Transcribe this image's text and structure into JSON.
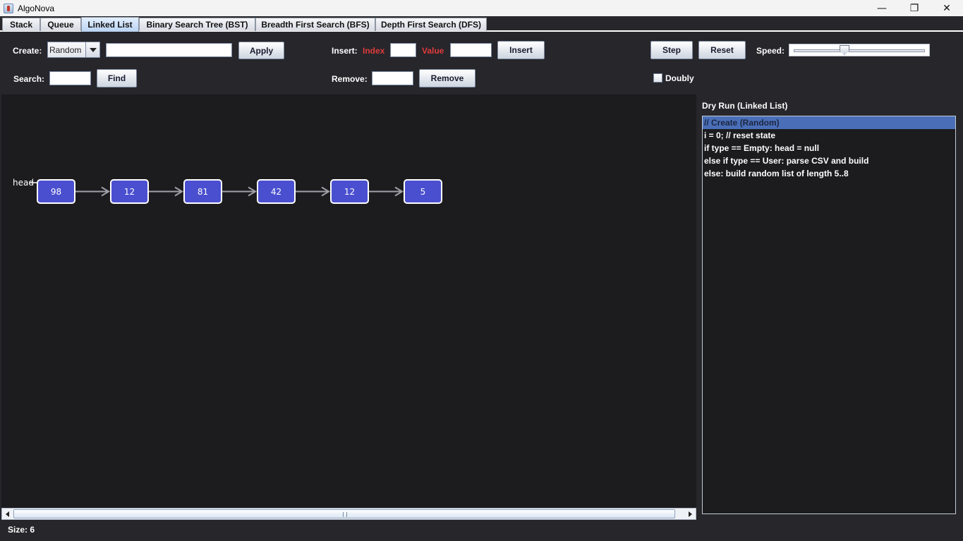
{
  "window": {
    "title": "AlgoNova"
  },
  "tabs": [
    {
      "label": "Stack"
    },
    {
      "label": "Queue"
    },
    {
      "label": "Linked List",
      "active": true
    },
    {
      "label": "Binary Search Tree (BST)"
    },
    {
      "label": "Breadth First Search (BFS)"
    },
    {
      "label": "Depth First Search (DFS)"
    }
  ],
  "toolbar": {
    "create_label": "Create:",
    "create_type": "Random",
    "create_input": "",
    "apply_label": "Apply",
    "insert_label": "Insert:",
    "index_label": "Index",
    "value_label": "Value",
    "index_input": "",
    "value_input": "",
    "insert_button": "Insert",
    "step_button": "Step",
    "reset_button": "Reset",
    "speed_label": "Speed:",
    "speed_fraction": 0.38,
    "search_label": "Search:",
    "search_input": "",
    "find_button": "Find",
    "remove_label": "Remove:",
    "remove_input": "",
    "remove_button": "Remove",
    "doubly_label": "Doubly",
    "doubly_checked": false
  },
  "canvas": {
    "head_label": "head",
    "nodes": [
      "98",
      "12",
      "81",
      "42",
      "12",
      "5"
    ]
  },
  "dry_run": {
    "title": "Dry Run (Linked List)",
    "lines": [
      "// Create (Random)",
      "i = 0; // reset state",
      "if type == Empty: head = null",
      "else if type == User: parse CSV and build",
      "else: build random list of length 5..8"
    ],
    "selected_index": 0
  },
  "status": {
    "size_text": "Size: 6"
  },
  "colors": {
    "node_fill": "#4a4fcf",
    "highlight": "#4a6fb8",
    "label_red": "#e03b3b"
  }
}
